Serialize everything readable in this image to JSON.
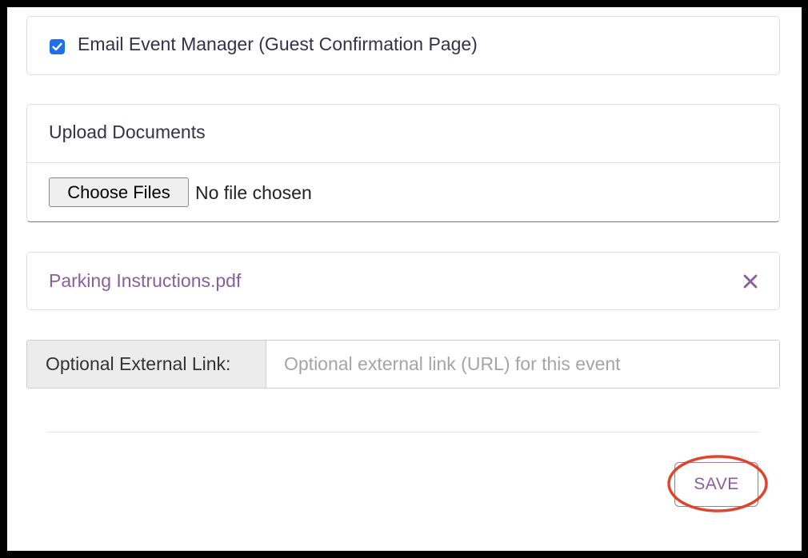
{
  "email_manager": {
    "label": "Email Event Manager (Guest Confirmation Page)",
    "checked": true
  },
  "upload": {
    "title": "Upload Documents",
    "button_label": "Choose Files",
    "status": "No file chosen"
  },
  "documents": [
    {
      "name": "Parking Instructions.pdf",
      "remove_icon": "close-icon"
    }
  ],
  "external_link": {
    "label": "Optional External Link:",
    "placeholder": "Optional external link (URL) for this event",
    "value": ""
  },
  "actions": {
    "save_label": "SAVE"
  },
  "colors": {
    "accent": "#8b5d9e",
    "checkbox": "#1f6feb",
    "highlight": "#e0442c"
  }
}
